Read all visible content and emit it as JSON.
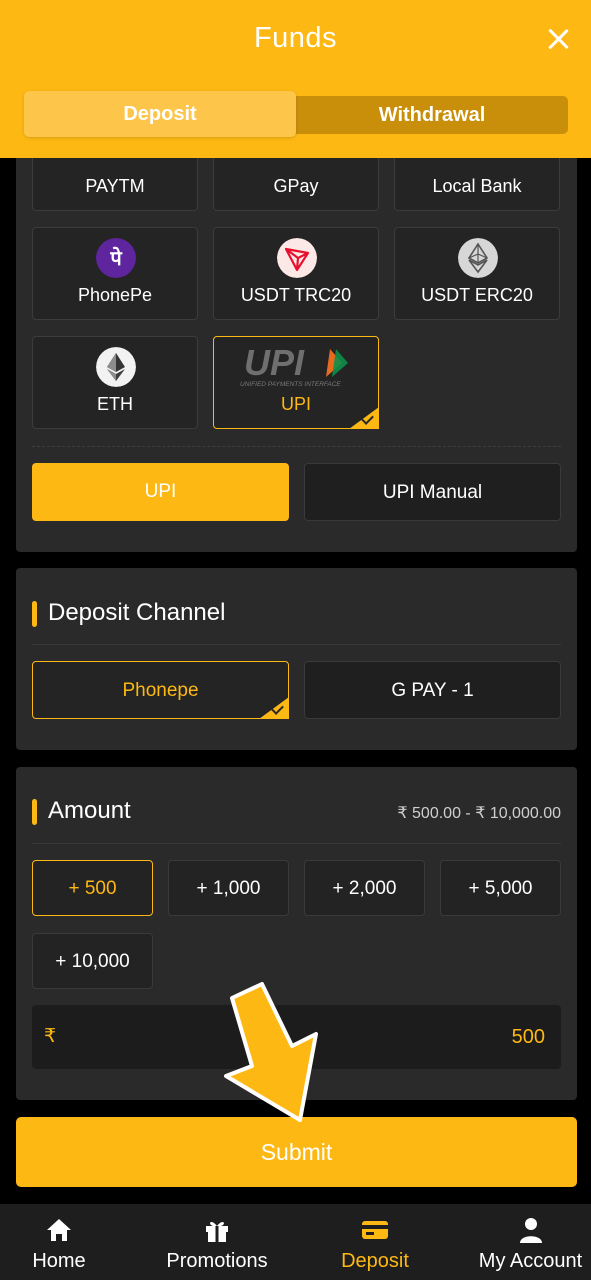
{
  "header": {
    "title": "Funds"
  },
  "tabs": {
    "deposit": "Deposit",
    "withdrawal": "Withdrawal"
  },
  "methods": [
    {
      "label": "PAYTM",
      "icon": "paytm-logo"
    },
    {
      "label": "GPay",
      "icon": "gpay-logo"
    },
    {
      "label": "Local Bank",
      "icon": "bank-logo"
    },
    {
      "label": "PhonePe",
      "icon": "phonepe-icon"
    },
    {
      "label": "USDT TRC20",
      "icon": "tron-icon"
    },
    {
      "label": "USDT ERC20",
      "icon": "ethereum-icon"
    },
    {
      "label": "ETH",
      "icon": "ethereum-icon"
    },
    {
      "label": "UPI",
      "icon": "upi-logo",
      "selected": true
    }
  ],
  "upi_logo": {
    "text": "UPI",
    "subtext": "UNIFIED PAYMENTS INTERFACE"
  },
  "upi_options": {
    "upi": "UPI",
    "upi_manual": "UPI Manual"
  },
  "channel": {
    "title": "Deposit Channel",
    "options": [
      {
        "label": "Phonepe",
        "selected": true
      },
      {
        "label": "G PAY - 1"
      }
    ]
  },
  "amount": {
    "title": "Amount",
    "range": "₹ 500.00 - ₹ 10,000.00",
    "quick": [
      "+ 500",
      "+ 1,000",
      "+ 2,000",
      "+ 5,000",
      "+ 10,000"
    ],
    "currency_symbol": "₹",
    "value": "500"
  },
  "submit_label": "Submit",
  "nav": [
    {
      "label": "Home",
      "icon": "home-icon"
    },
    {
      "label": "Promotions",
      "icon": "gift-icon"
    },
    {
      "label": "Deposit",
      "icon": "card-icon",
      "active": true
    },
    {
      "label": "My Account",
      "icon": "user-icon"
    }
  ],
  "colors": {
    "accent": "#fdb813",
    "panel": "#2a2a2a",
    "background": "#000000"
  }
}
